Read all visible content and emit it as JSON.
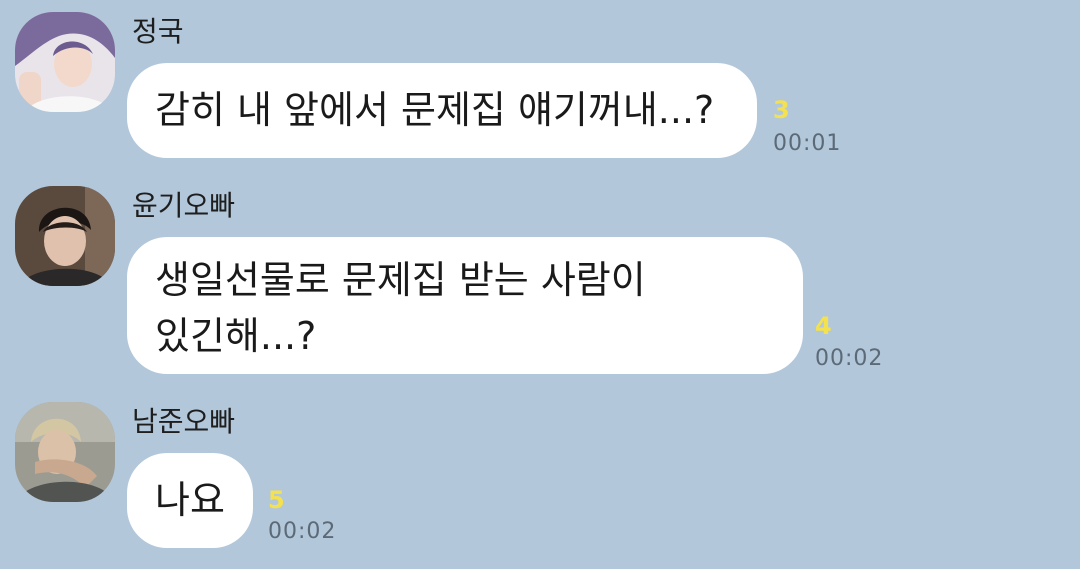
{
  "messages": [
    {
      "sender": "정국",
      "lines": [
        "감히 내 앞에서 문제집 얘기꺼내...?"
      ],
      "unread_count": "3",
      "time": "00:01"
    },
    {
      "sender": "윤기오빠",
      "lines": [
        "생일선물로 문제집 받는 사람이",
        "있긴해...?"
      ],
      "unread_count": "4",
      "time": "00:02"
    },
    {
      "sender": "남준오빠",
      "lines": [
        "나요"
      ],
      "unread_count": "5",
      "time": "00:02"
    }
  ],
  "colors": {
    "chat_background": "#b2c7da",
    "bubble": "#ffffff",
    "unread_count": "#f4e14f",
    "timestamp": "#5c6a78"
  }
}
